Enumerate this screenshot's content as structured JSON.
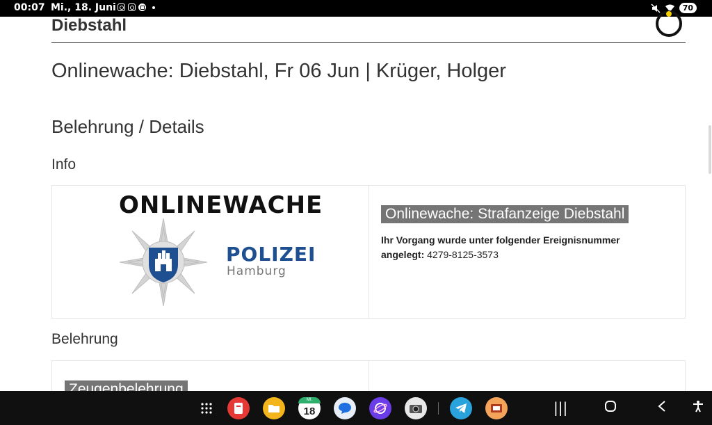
{
  "status_bar": {
    "time": "00:07",
    "date": "Mi., 18. Juni",
    "battery": "70",
    "notification_icons": [
      "instagram-icon",
      "instagram-icon",
      "app-icon",
      "dot"
    ],
    "right_icons": [
      "mute-icon",
      "wifi-icon",
      "battery-icon"
    ]
  },
  "page": {
    "heading": "Diebstahl",
    "title": "Onlinewache: Diebstahl, Fr 06 Jun | Krüger, Holger",
    "section_title": "Belehrung / Details",
    "info_label": "Info",
    "belehrung_label": "Belehrung"
  },
  "logo": {
    "word": "ONLINEWACHE",
    "polizei": "POLIZEI",
    "hamburg": "Hamburg",
    "brand_color": "#1d4f91"
  },
  "info_card": {
    "tag": "Onlinewache: Strafanzeige Diebstahl",
    "text_bold": "Ihr Vorgang wurde unter folgender Ereignisnummer angelegt:",
    "number": "4279-8125-3573"
  },
  "belehrung_card": {
    "tag": "Zeugenbelehrung"
  },
  "taskbar": {
    "apps": [
      "apps-grid-icon",
      "notes-app-icon",
      "files-app-icon",
      "calendar-app-icon",
      "messages-app-icon",
      "browser-app-icon",
      "camera-app-icon",
      "telegram-app-icon",
      "slides-app-icon"
    ],
    "calendar_day": "18",
    "calendar_month": "MI."
  }
}
